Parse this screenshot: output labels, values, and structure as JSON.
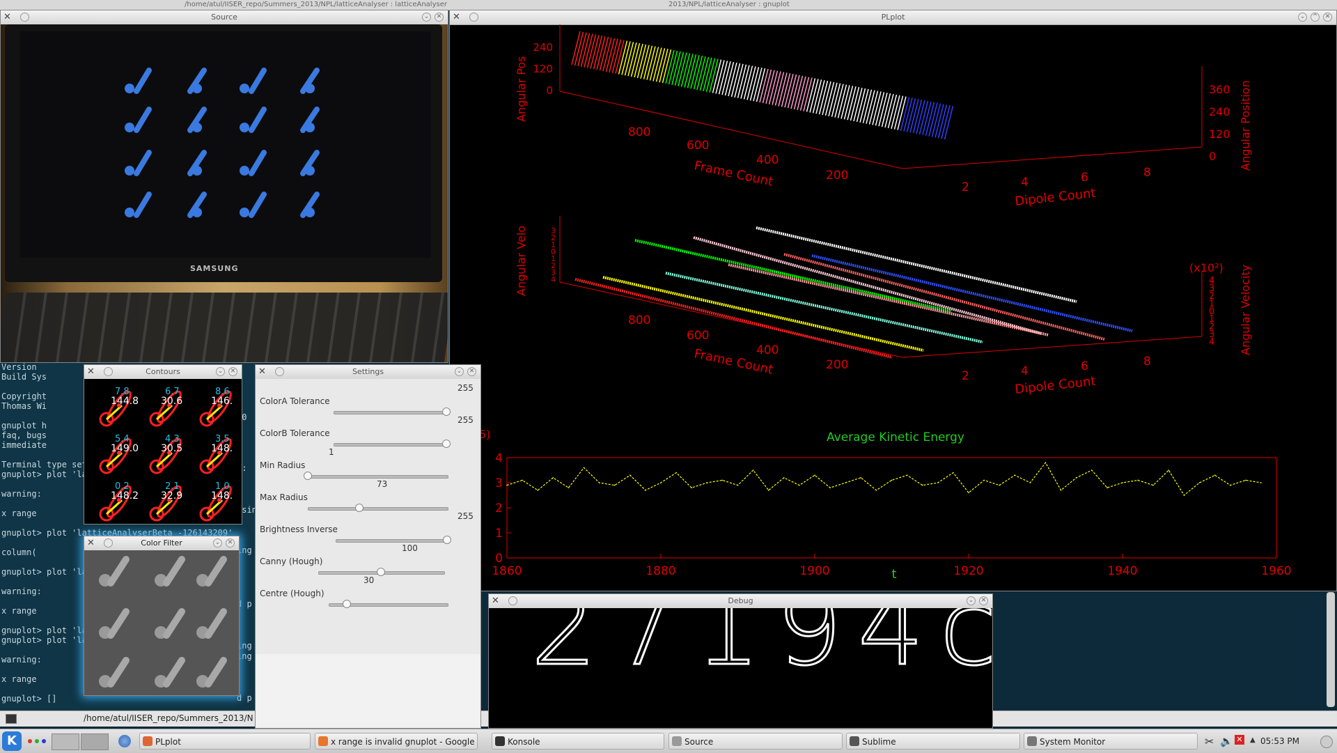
{
  "desktop": {
    "top_title_left": "/home/atul/IISER_repo/Summers_2013/NPL/latticeAnalyser : latticeAnalyser",
    "top_title_right": "2013/NPL/latticeAnalyser : gnuplot"
  },
  "terminal": {
    "lines": [
      "Version",
      "Build Sys",
      "",
      "Copyright",
      "Thomas Wi",
      "",
      "gnuplot h",
      "faq, bugs",
      "immediate",
      "",
      "Terminal type set",
      "gnuplot> plot 'la",
      "",
      "         warning:",
      "",
      "         x range",
      "",
      "gnuplot> plot 'latticeAnalyserBeta -126143209' using",
      "",
      "         column(",
      "",
      "gnuplot> plot 'la",
      "",
      "         warning:",
      "",
      "         x range",
      "",
      "gnuplot> plot 'la",
      "gnuplot> plot 'la",
      "",
      "         warning:",
      "",
      "         x range",
      "",
      "gnuplot> []"
    ],
    "right_fragments": [
      "20",
      "w:",
      "using",
      "ing",
      "d p",
      "ing",
      "ing",
      "d p"
    ],
    "path": "/home/atul/IISER_repo/Summers_2013/N"
  },
  "windows": {
    "source": {
      "title": "Source",
      "brand": "SAMSUNG"
    },
    "plplot": {
      "title": "PLplot"
    },
    "contours": {
      "title": "Contours",
      "cells": [
        {
          "top": "7.8",
          "bottom": "144.8"
        },
        {
          "top": "6.7",
          "bottom": "30.6"
        },
        {
          "top": "8.6",
          "bottom": "146."
        },
        {
          "top": "5.4",
          "bottom": "149.0"
        },
        {
          "top": "4.3",
          "bottom": "30.5"
        },
        {
          "top": "3.5",
          "bottom": "148."
        },
        {
          "top": "0.2",
          "bottom": "148.2"
        },
        {
          "top": "2.1",
          "bottom": "32.9"
        },
        {
          "top": "1.0",
          "bottom": "148."
        }
      ]
    },
    "color_filter": {
      "title": "Color Filter"
    },
    "settings": {
      "title": "Settings",
      "sliders": [
        {
          "label": "ColorA Tolerance",
          "value": "255",
          "fraction": 1.0
        },
        {
          "label": "ColorB Tolerance",
          "value": "255",
          "fraction": 1.0
        },
        {
          "label": "Min Radius",
          "value": "1",
          "fraction": 0.0
        },
        {
          "label": "Max Radius",
          "value": "73",
          "fraction": 0.37
        },
        {
          "label": "Brightness Inverse",
          "value": "255",
          "fraction": 1.0
        },
        {
          "label": "Canny (Hough)",
          "value": "100",
          "fraction": 0.5
        },
        {
          "label": "Centre (Hough)",
          "value": "30",
          "fraction": 0.15
        }
      ]
    },
    "debug": {
      "title": "Debug",
      "digits": "27194c"
    }
  },
  "plot": {
    "top3d": {
      "ylabel": "Angular Pos",
      "zticks": [
        "240",
        "120",
        "0"
      ],
      "xticks": [
        "800",
        "600",
        "400",
        "200"
      ],
      "xlabel": "Frame Count",
      "yticks": [
        "2",
        "4",
        "6",
        "8"
      ],
      "ylabel2": "Dipole Count",
      "rticks": [
        "360",
        "240",
        "120",
        "0"
      ],
      "rlabel": "Angular Position"
    },
    "mid3d": {
      "ylabel": "Angular Velo",
      "zticks": [
        "3",
        "2",
        "1",
        "0",
        "1",
        "2",
        "3",
        "4"
      ],
      "xticks": [
        "800",
        "600",
        "400",
        "200"
      ],
      "xlabel": "Frame Count",
      "yticks": [
        "2",
        "4",
        "6",
        "8"
      ],
      "ylabel2": "Dipole Count",
      "rscale": "(x10²)",
      "rticks": [
        "4",
        "3",
        "2",
        "1",
        "0",
        "1",
        "2",
        "3",
        "4"
      ],
      "rlabel": "Angular Velocity"
    },
    "ke_left_fragment": "5)"
  },
  "chart_data": {
    "type": "line",
    "title": "Average Kinetic Energy",
    "xlabel": "t",
    "ylabel": "",
    "xlim": [
      1860,
      1960
    ],
    "ylim": [
      0,
      4
    ],
    "xticks": [
      "1860",
      "1880",
      "1900",
      "1920",
      "1940",
      "1960"
    ],
    "yticks": [
      "4",
      "3",
      "2",
      "1",
      "0"
    ],
    "color": "#ffff00",
    "series": [
      {
        "x": [
          1860,
          1862,
          1864,
          1866,
          1868,
          1870,
          1872,
          1874,
          1876,
          1878,
          1880,
          1882,
          1884,
          1886,
          1888,
          1890,
          1892,
          1894,
          1896,
          1898,
          1900,
          1902,
          1904,
          1906,
          1908,
          1910,
          1912,
          1914,
          1916,
          1918,
          1920,
          1922,
          1924,
          1926,
          1928,
          1930,
          1932,
          1934,
          1936,
          1938,
          1940,
          1942,
          1944,
          1946,
          1948,
          1950,
          1952,
          1954,
          1956,
          1958
        ],
        "values": [
          2.9,
          3.1,
          2.7,
          3.2,
          2.8,
          3.6,
          3.0,
          2.9,
          3.3,
          2.7,
          3.0,
          3.4,
          2.8,
          3.0,
          3.1,
          2.9,
          3.5,
          2.7,
          3.2,
          2.9,
          3.3,
          2.8,
          3.0,
          3.2,
          2.7,
          3.1,
          3.3,
          2.9,
          3.0,
          3.4,
          2.6,
          3.1,
          2.9,
          3.3,
          3.0,
          3.8,
          2.7,
          3.2,
          3.5,
          2.8,
          3.0,
          3.1,
          2.9,
          3.5,
          2.5,
          3.0,
          3.3,
          2.9,
          3.1,
          3.0
        ]
      }
    ]
  },
  "taskbar": {
    "items": [
      {
        "label": "PLplot",
        "color": "#dd6633"
      },
      {
        "label": "x range is invalid gnuplot - Google",
        "color": "#e8762b"
      },
      {
        "label": "Konsole",
        "color": "#333333"
      },
      {
        "label": "Source",
        "color": "#999999"
      },
      {
        "label": "Sublime",
        "color": "#555555"
      },
      {
        "label": "System Monitor",
        "color": "#777777"
      }
    ],
    "clock": "05:53 PM"
  }
}
